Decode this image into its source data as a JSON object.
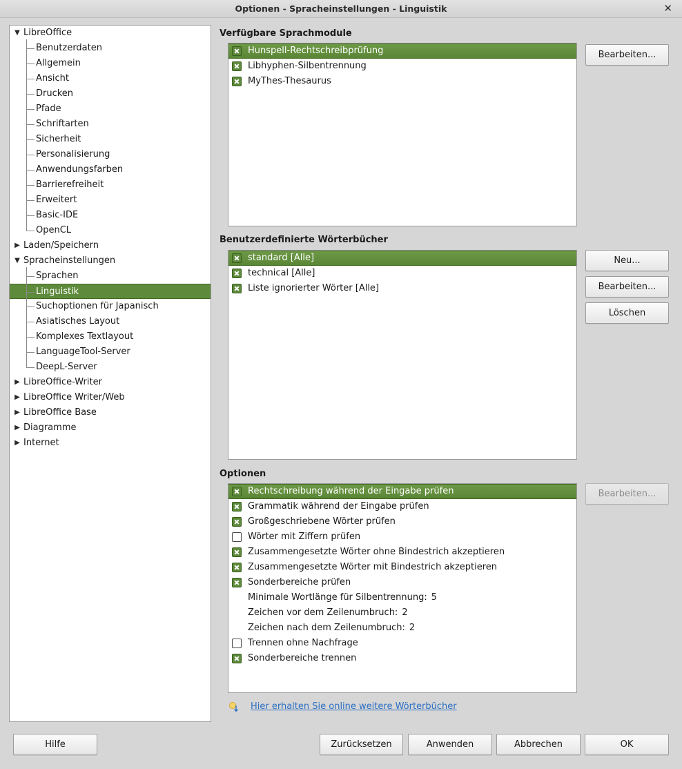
{
  "window": {
    "title": "Optionen - Spracheinstellungen - Linguistik",
    "close_glyph": "✕"
  },
  "tree": {
    "items": [
      {
        "label": "LibreOffice",
        "level": 0,
        "expander": "expanded"
      },
      {
        "label": "Benutzerdaten",
        "level": 1
      },
      {
        "label": "Allgemein",
        "level": 1
      },
      {
        "label": "Ansicht",
        "level": 1
      },
      {
        "label": "Drucken",
        "level": 1
      },
      {
        "label": "Pfade",
        "level": 1
      },
      {
        "label": "Schriftarten",
        "level": 1
      },
      {
        "label": "Sicherheit",
        "level": 1
      },
      {
        "label": "Personalisierung",
        "level": 1
      },
      {
        "label": "Anwendungsfarben",
        "level": 1
      },
      {
        "label": "Barrierefreiheit",
        "level": 1
      },
      {
        "label": "Erweitert",
        "level": 1
      },
      {
        "label": "Basic-IDE",
        "level": 1
      },
      {
        "label": "OpenCL",
        "level": 1
      },
      {
        "label": "Laden/Speichern",
        "level": 0,
        "expander": "collapsed"
      },
      {
        "label": "Spracheinstellungen",
        "level": 0,
        "expander": "expanded"
      },
      {
        "label": "Sprachen",
        "level": 1
      },
      {
        "label": "Linguistik",
        "level": 1,
        "selected": true
      },
      {
        "label": "Suchoptionen für Japanisch",
        "level": 1
      },
      {
        "label": "Asiatisches Layout",
        "level": 1
      },
      {
        "label": "Komplexes Textlayout",
        "level": 1
      },
      {
        "label": "LanguageTool-Server",
        "level": 1
      },
      {
        "label": "DeepL-Server",
        "level": 1
      },
      {
        "label": "LibreOffice-Writer",
        "level": 0,
        "expander": "collapsed"
      },
      {
        "label": "LibreOffice Writer/Web",
        "level": 0,
        "expander": "collapsed"
      },
      {
        "label": "LibreOffice Base",
        "level": 0,
        "expander": "collapsed"
      },
      {
        "label": "Diagramme",
        "level": 0,
        "expander": "collapsed"
      },
      {
        "label": "Internet",
        "level": 0,
        "expander": "collapsed"
      }
    ]
  },
  "modules": {
    "heading": "Verfügbare Sprachmodule",
    "items": [
      {
        "label": "Hunspell-Rechtschreibprüfung",
        "checked": true,
        "selected": true
      },
      {
        "label": "Libhyphen-Silbentrennung",
        "checked": true
      },
      {
        "label": "MyThes-Thesaurus",
        "checked": true
      }
    ],
    "edit_button": "Bearbeiten..."
  },
  "dictionaries": {
    "heading": "Benutzerdefinierte Wörterbücher",
    "items": [
      {
        "label": "standard [Alle]",
        "checked": true,
        "selected": true
      },
      {
        "label": "technical [Alle]",
        "checked": true
      },
      {
        "label": "Liste ignorierter Wörter [Alle]",
        "checked": true
      }
    ],
    "new_button": "Neu...",
    "edit_button": "Bearbeiten...",
    "delete_button": "Löschen"
  },
  "options": {
    "heading": "Optionen",
    "items": [
      {
        "label": "Rechtschreibung während der Eingabe prüfen",
        "checked": true,
        "selected": true,
        "type": "checkbox"
      },
      {
        "label": "Grammatik während der Eingabe prüfen",
        "checked": true,
        "type": "checkbox"
      },
      {
        "label": "Großgeschriebene Wörter prüfen",
        "checked": true,
        "type": "checkbox"
      },
      {
        "label": "Wörter mit Ziffern prüfen",
        "checked": false,
        "type": "checkbox"
      },
      {
        "label": "Zusammengesetzte Wörter ohne Bindestrich akzeptieren",
        "checked": true,
        "type": "checkbox"
      },
      {
        "label": "Zusammengesetzte Wörter mit Bindestrich akzeptieren",
        "checked": true,
        "type": "checkbox"
      },
      {
        "label": "Sonderbereiche prüfen",
        "checked": true,
        "type": "checkbox"
      },
      {
        "label": "Minimale Wortlänge für Silbentrennung:",
        "value": "5",
        "type": "value"
      },
      {
        "label": "Zeichen vor dem Zeilenumbruch:",
        "value": "2",
        "type": "value"
      },
      {
        "label": "Zeichen nach dem Zeilenumbruch:",
        "value": "2",
        "type": "value"
      },
      {
        "label": "Trennen ohne Nachfrage",
        "checked": false,
        "type": "checkbox"
      },
      {
        "label": "Sonderbereiche trennen",
        "checked": true,
        "type": "checkbox"
      }
    ],
    "edit_button": "Bearbeiten..."
  },
  "more_dictionaries_link": "Hier erhalten Sie online weitere Wörterbücher",
  "footer": {
    "help": "Hilfe",
    "reset": "Zurücksetzen",
    "apply": "Anwenden",
    "cancel": "Abbrechen",
    "ok": "OK"
  },
  "colors": {
    "selection": "#5e8a3b",
    "link": "#2a6fc4",
    "background": "#d6d6d6"
  }
}
